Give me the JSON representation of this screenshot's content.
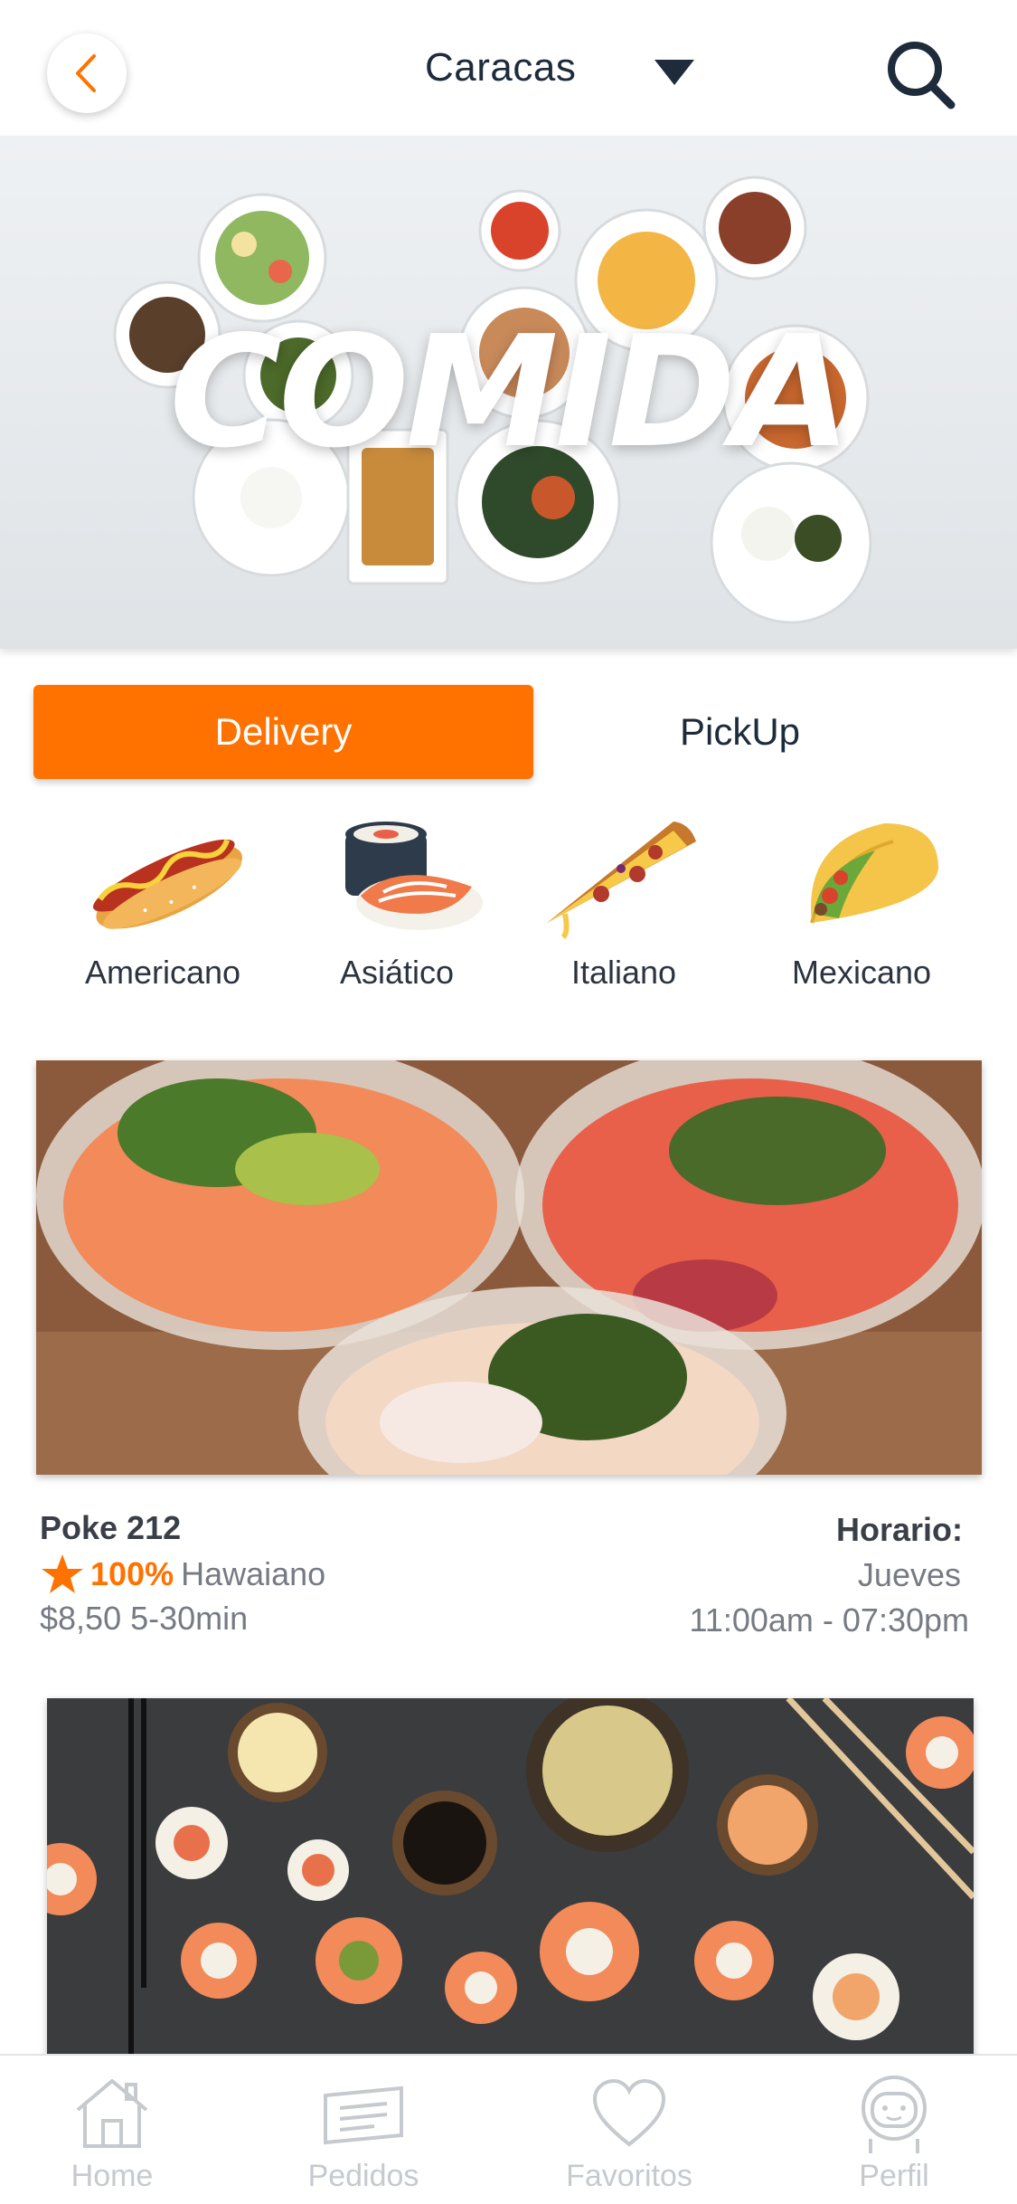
{
  "header": {
    "city": "Caracas"
  },
  "banner": {
    "title": "COMIDA"
  },
  "mode_tabs": {
    "delivery": "Delivery",
    "pickup": "PickUp",
    "active": "Delivery"
  },
  "categories": [
    {
      "label": "Americano",
      "icon": "hotdog-icon"
    },
    {
      "label": "Asiático",
      "icon": "sushi-icon"
    },
    {
      "label": "Italiano",
      "icon": "pizza-icon"
    },
    {
      "label": "Mexicano",
      "icon": "taco-icon"
    }
  ],
  "restaurants": [
    {
      "name": "Poke 212",
      "rating": "100%",
      "cuisine": "Hawaiano",
      "price_time": "$8,50  5-30min",
      "hours_label": "Horario:",
      "day": "Jueves",
      "hours": "11:00am - 07:30pm"
    }
  ],
  "bottom_nav": [
    {
      "label": "Home",
      "icon": "home-icon"
    },
    {
      "label": "Pedidos",
      "icon": "ticket-icon"
    },
    {
      "label": "Favoritos",
      "icon": "heart-icon"
    },
    {
      "label": "Perfil",
      "icon": "astronaut-icon"
    }
  ],
  "colors": {
    "accent": "#ff7200",
    "text_dark": "#1e2b3b",
    "text_muted": "#767b83",
    "nav_inactive": "#c6c9cd"
  }
}
